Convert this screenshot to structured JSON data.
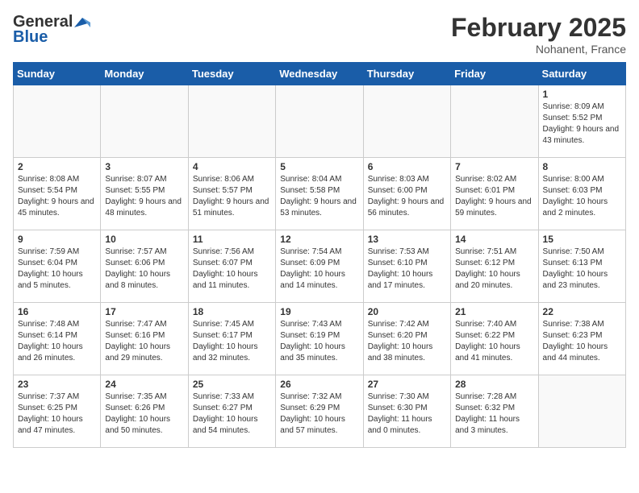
{
  "header": {
    "logo_general": "General",
    "logo_blue": "Blue",
    "month": "February 2025",
    "location": "Nohanent, France"
  },
  "weekdays": [
    "Sunday",
    "Monday",
    "Tuesday",
    "Wednesday",
    "Thursday",
    "Friday",
    "Saturday"
  ],
  "weeks": [
    [
      {
        "day": "",
        "info": ""
      },
      {
        "day": "",
        "info": ""
      },
      {
        "day": "",
        "info": ""
      },
      {
        "day": "",
        "info": ""
      },
      {
        "day": "",
        "info": ""
      },
      {
        "day": "",
        "info": ""
      },
      {
        "day": "1",
        "info": "Sunrise: 8:09 AM\nSunset: 5:52 PM\nDaylight: 9 hours and 43 minutes."
      }
    ],
    [
      {
        "day": "2",
        "info": "Sunrise: 8:08 AM\nSunset: 5:54 PM\nDaylight: 9 hours and 45 minutes."
      },
      {
        "day": "3",
        "info": "Sunrise: 8:07 AM\nSunset: 5:55 PM\nDaylight: 9 hours and 48 minutes."
      },
      {
        "day": "4",
        "info": "Sunrise: 8:06 AM\nSunset: 5:57 PM\nDaylight: 9 hours and 51 minutes."
      },
      {
        "day": "5",
        "info": "Sunrise: 8:04 AM\nSunset: 5:58 PM\nDaylight: 9 hours and 53 minutes."
      },
      {
        "day": "6",
        "info": "Sunrise: 8:03 AM\nSunset: 6:00 PM\nDaylight: 9 hours and 56 minutes."
      },
      {
        "day": "7",
        "info": "Sunrise: 8:02 AM\nSunset: 6:01 PM\nDaylight: 9 hours and 59 minutes."
      },
      {
        "day": "8",
        "info": "Sunrise: 8:00 AM\nSunset: 6:03 PM\nDaylight: 10 hours and 2 minutes."
      }
    ],
    [
      {
        "day": "9",
        "info": "Sunrise: 7:59 AM\nSunset: 6:04 PM\nDaylight: 10 hours and 5 minutes."
      },
      {
        "day": "10",
        "info": "Sunrise: 7:57 AM\nSunset: 6:06 PM\nDaylight: 10 hours and 8 minutes."
      },
      {
        "day": "11",
        "info": "Sunrise: 7:56 AM\nSunset: 6:07 PM\nDaylight: 10 hours and 11 minutes."
      },
      {
        "day": "12",
        "info": "Sunrise: 7:54 AM\nSunset: 6:09 PM\nDaylight: 10 hours and 14 minutes."
      },
      {
        "day": "13",
        "info": "Sunrise: 7:53 AM\nSunset: 6:10 PM\nDaylight: 10 hours and 17 minutes."
      },
      {
        "day": "14",
        "info": "Sunrise: 7:51 AM\nSunset: 6:12 PM\nDaylight: 10 hours and 20 minutes."
      },
      {
        "day": "15",
        "info": "Sunrise: 7:50 AM\nSunset: 6:13 PM\nDaylight: 10 hours and 23 minutes."
      }
    ],
    [
      {
        "day": "16",
        "info": "Sunrise: 7:48 AM\nSunset: 6:14 PM\nDaylight: 10 hours and 26 minutes."
      },
      {
        "day": "17",
        "info": "Sunrise: 7:47 AM\nSunset: 6:16 PM\nDaylight: 10 hours and 29 minutes."
      },
      {
        "day": "18",
        "info": "Sunrise: 7:45 AM\nSunset: 6:17 PM\nDaylight: 10 hours and 32 minutes."
      },
      {
        "day": "19",
        "info": "Sunrise: 7:43 AM\nSunset: 6:19 PM\nDaylight: 10 hours and 35 minutes."
      },
      {
        "day": "20",
        "info": "Sunrise: 7:42 AM\nSunset: 6:20 PM\nDaylight: 10 hours and 38 minutes."
      },
      {
        "day": "21",
        "info": "Sunrise: 7:40 AM\nSunset: 6:22 PM\nDaylight: 10 hours and 41 minutes."
      },
      {
        "day": "22",
        "info": "Sunrise: 7:38 AM\nSunset: 6:23 PM\nDaylight: 10 hours and 44 minutes."
      }
    ],
    [
      {
        "day": "23",
        "info": "Sunrise: 7:37 AM\nSunset: 6:25 PM\nDaylight: 10 hours and 47 minutes."
      },
      {
        "day": "24",
        "info": "Sunrise: 7:35 AM\nSunset: 6:26 PM\nDaylight: 10 hours and 50 minutes."
      },
      {
        "day": "25",
        "info": "Sunrise: 7:33 AM\nSunset: 6:27 PM\nDaylight: 10 hours and 54 minutes."
      },
      {
        "day": "26",
        "info": "Sunrise: 7:32 AM\nSunset: 6:29 PM\nDaylight: 10 hours and 57 minutes."
      },
      {
        "day": "27",
        "info": "Sunrise: 7:30 AM\nSunset: 6:30 PM\nDaylight: 11 hours and 0 minutes."
      },
      {
        "day": "28",
        "info": "Sunrise: 7:28 AM\nSunset: 6:32 PM\nDaylight: 11 hours and 3 minutes."
      },
      {
        "day": "",
        "info": ""
      }
    ]
  ]
}
